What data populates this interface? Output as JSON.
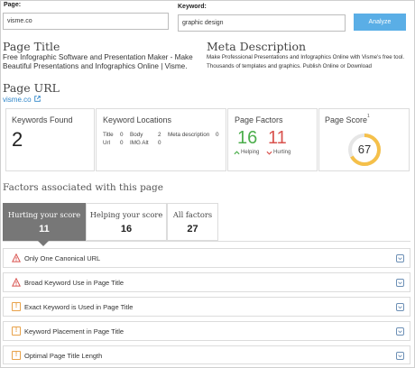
{
  "form": {
    "page_label": "Page:",
    "page_value": "visme.co",
    "keyword_label": "Keyword:",
    "keyword_value": "graphic design",
    "analyze_label": "Analyze"
  },
  "meta": {
    "title_heading": "Page Title",
    "title_text": "Free Infographic Software and Presentation Maker - Make Beautiful Presentations and Infographics Online | Visme.",
    "desc_heading": "Meta Description",
    "desc_text": "Make Professional Presentations and Infographics Online with Visme's free tool. Thousands of templates and graphics. Publish Online or Download",
    "url_heading": "Page URL",
    "url_text": "visme.co"
  },
  "cards": {
    "keywords_found": {
      "title": "Keywords Found",
      "value": "2"
    },
    "keyword_locations": {
      "title": "Keyword Locations",
      "items": [
        {
          "label": "Title",
          "value": "0"
        },
        {
          "label": "Body",
          "value": "2"
        },
        {
          "label": "Meta description",
          "value": "0"
        },
        {
          "label": "Url",
          "value": "0"
        },
        {
          "label": "IMG Alt",
          "value": "0"
        }
      ]
    },
    "page_factors": {
      "title": "Page Factors",
      "helping": "16",
      "hurting": "11",
      "helping_label": "Helping",
      "hurting_label": "Hurting"
    },
    "page_score": {
      "title": "Page Score",
      "superscript": "1",
      "value": "67",
      "fraction": 0.67
    }
  },
  "factors": {
    "heading": "Factors associated with this page",
    "tabs": [
      {
        "label": "Hurting your score",
        "count": "11"
      },
      {
        "label": "Helping your score",
        "count": "16"
      },
      {
        "label": "All factors",
        "count": "27"
      }
    ],
    "rows": [
      {
        "text": "Only One Canonical URL",
        "icon": "warning-triangle-icon"
      },
      {
        "text": "Broad Keyword Use in Page Title",
        "icon": "warning-triangle-icon"
      },
      {
        "text": "Exact Keyword is Used in Page Title",
        "icon": "exclamation-box-icon"
      },
      {
        "text": "Keyword Placement in Page Title",
        "icon": "exclamation-box-icon"
      },
      {
        "text": "Optimal Page Title Length",
        "icon": "exclamation-box-icon"
      }
    ]
  },
  "colors": {
    "accent": "#5aaee6",
    "link": "#2f86c9",
    "helping": "#4cae4c",
    "hurting": "#d9534f",
    "score_ring": "#f5c04a",
    "active_tab": "#777777"
  }
}
